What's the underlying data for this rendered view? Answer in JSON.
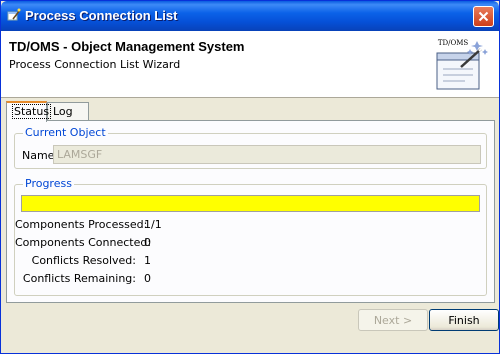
{
  "window": {
    "title": "Process Connection List",
    "title_icon": "wizard-wand-icon",
    "close_icon": "close-icon"
  },
  "header": {
    "title": "TD/OMS - Object Management System",
    "subtitle": "Process Connection List Wizard",
    "graphic_label": "TD/OMS",
    "graphic_icon": "wizard-window-wand-icon"
  },
  "tabs": [
    {
      "label": "Status",
      "active": true
    },
    {
      "label": "Log",
      "active": false
    }
  ],
  "current_object": {
    "legend": "Current Object",
    "name_label": "Name",
    "name_value": "LAMSGF"
  },
  "progress": {
    "legend": "Progress",
    "percent": 100,
    "bar_color": "#ffff00",
    "stats": [
      {
        "label": "Components Processed:",
        "value": "1/1"
      },
      {
        "label": "Components Connected:",
        "value": "0"
      },
      {
        "label": "Conflicts Resolved:",
        "value": "1"
      },
      {
        "label": "Conflicts Remaining:",
        "value": "0"
      }
    ]
  },
  "buttons": {
    "next": {
      "label": "Next >",
      "enabled": false
    },
    "finish": {
      "label": "Finish",
      "enabled": true
    }
  },
  "colors": {
    "title_bar": "#0b62e8",
    "legend_text": "#0046d5",
    "active_tab_highlight": "#e68b2c"
  }
}
